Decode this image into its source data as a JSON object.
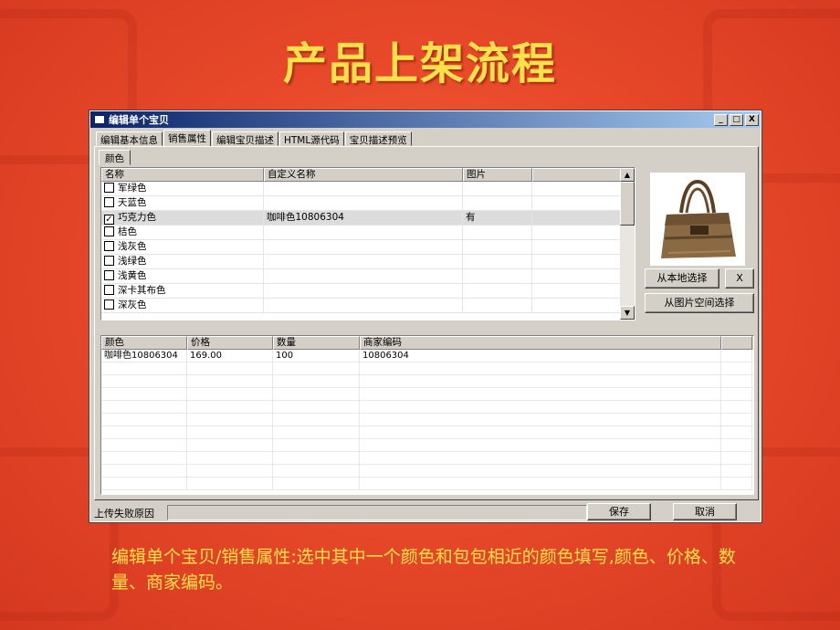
{
  "slide": {
    "title": "产品上架流程",
    "caption": "编辑单个宝贝/销售属性:选中其中一个颜色和包包相近的颜色填写,颜色、价格、数量、商家编码。"
  },
  "window": {
    "title": "编辑单个宝贝",
    "controls": {
      "minimize": "_",
      "maximize": "□",
      "close": "X"
    },
    "tabs": [
      "编辑基本信息",
      "销售属性",
      "编辑宝贝描述",
      "HTML源代码",
      "宝贝描述预览"
    ],
    "active_tab": "销售属性",
    "subtab": "颜色",
    "color_grid": {
      "headers": [
        "名称",
        "自定义名称",
        "图片"
      ],
      "rows": [
        {
          "name": "军绿色",
          "custom": "",
          "image": "",
          "checked": false
        },
        {
          "name": "天蓝色",
          "custom": "",
          "image": "",
          "checked": false
        },
        {
          "name": "巧克力色",
          "custom": "咖啡色10806304",
          "image": "有",
          "checked": true
        },
        {
          "name": "桔色",
          "custom": "",
          "image": "",
          "checked": false
        },
        {
          "name": "浅灰色",
          "custom": "",
          "image": "",
          "checked": false
        },
        {
          "name": "浅绿色",
          "custom": "",
          "image": "",
          "checked": false
        },
        {
          "name": "浅黄色",
          "custom": "",
          "image": "",
          "checked": false
        },
        {
          "name": "深卡其布色",
          "custom": "",
          "image": "",
          "checked": false
        },
        {
          "name": "深灰色",
          "custom": "",
          "image": "",
          "checked": false
        }
      ]
    },
    "image_buttons": {
      "local": "从本地选择",
      "clear": "X",
      "space": "从图片空间选择"
    },
    "sku_grid": {
      "headers": [
        "颜色",
        "价格",
        "数量",
        "商家编码"
      ],
      "rows": [
        {
          "color": "咖啡色10806304",
          "price": "169.00",
          "qty": "100",
          "code": "10806304"
        }
      ]
    },
    "status": {
      "label": "上传失败原因",
      "save": "保存",
      "cancel": "取消"
    }
  },
  "colors": {
    "title_yellow": "#ffe24a",
    "bg_red": "#e8492a",
    "window_gray": "#d4d0c8"
  }
}
